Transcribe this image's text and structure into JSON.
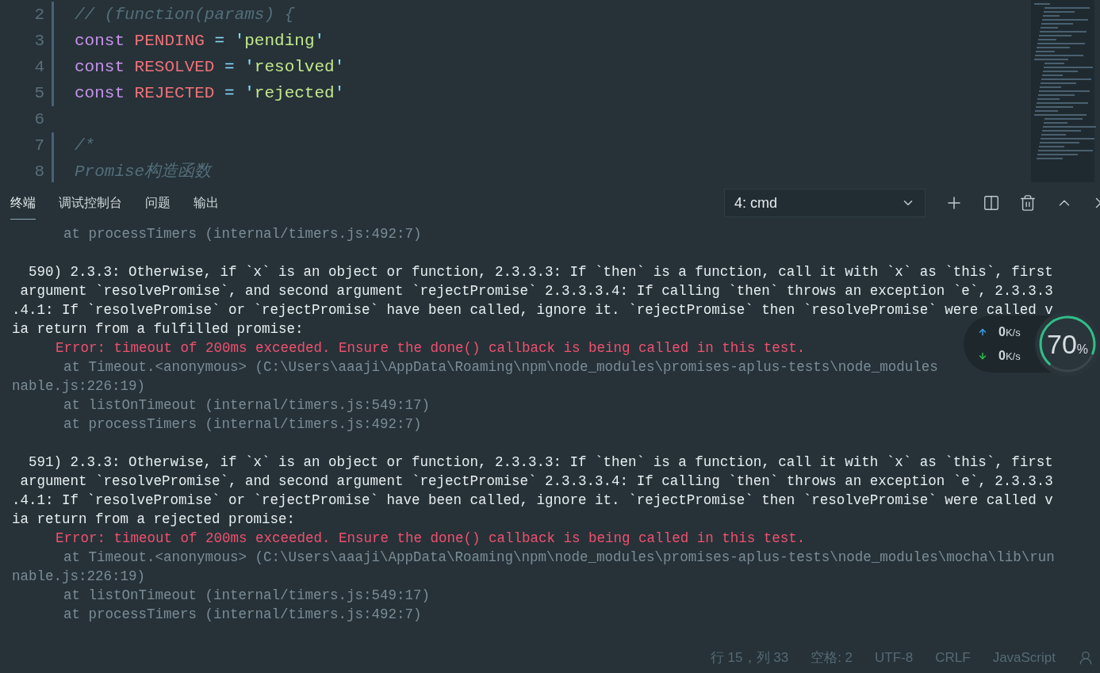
{
  "editor": {
    "lines": [
      {
        "number": "2",
        "tokens": [
          {
            "text": "// (function(params) {",
            "kind": "comment"
          }
        ]
      },
      {
        "number": "3",
        "tokens": [
          {
            "text": "const",
            "kind": "keyword"
          },
          {
            "text": " PENDING",
            "kind": "constant"
          },
          {
            "text": " = ",
            "kind": "operator"
          },
          {
            "text": "'",
            "kind": "operator"
          },
          {
            "text": "pending",
            "kind": "string"
          },
          {
            "text": "'",
            "kind": "operator"
          }
        ]
      },
      {
        "number": "4",
        "tokens": [
          {
            "text": "const",
            "kind": "keyword"
          },
          {
            "text": " RESOLVED",
            "kind": "constant"
          },
          {
            "text": " = ",
            "kind": "operator"
          },
          {
            "text": "'",
            "kind": "operator"
          },
          {
            "text": "resolved",
            "kind": "string"
          },
          {
            "text": "'",
            "kind": "operator"
          }
        ]
      },
      {
        "number": "5",
        "tokens": [
          {
            "text": "const",
            "kind": "keyword"
          },
          {
            "text": " REJECTED",
            "kind": "constant"
          },
          {
            "text": " = ",
            "kind": "operator"
          },
          {
            "text": "'",
            "kind": "operator"
          },
          {
            "text": "rejected",
            "kind": "string"
          },
          {
            "text": "'",
            "kind": "operator"
          }
        ]
      },
      {
        "number": "6"
      },
      {
        "number": "7",
        "tokens": [
          {
            "text": "/*",
            "kind": "comment"
          }
        ]
      },
      {
        "number": "8",
        "tokens": [
          {
            "text": "Promise构造函数",
            "kind": "comment"
          }
        ]
      }
    ]
  },
  "panel": {
    "tabs": [
      {
        "label": "终端",
        "selected": true
      },
      {
        "label": "调试控制台",
        "selected": false
      },
      {
        "label": "问题",
        "selected": false
      },
      {
        "label": "输出",
        "selected": false
      }
    ],
    "terminal_select": "4: cmd",
    "lines": [
      {
        "kind": "trace",
        "text": "at processTimers (internal/timers.js:492:7)"
      },
      {
        "kind": "blank"
      },
      {
        "kind": "head",
        "text": "590) 2.3.3: Otherwise, if `x` is an object or function, 2.3.3.3: If `then` is a function, call it with `x` as `this`, first"
      },
      {
        "kind": "wrap",
        "text": " argument `resolvePromise`, and second argument `rejectPromise` 2.3.3.3.4: If calling `then` throws an exception `e`, 2.3.3.3"
      },
      {
        "kind": "wrap",
        "text": ".4.1: If `resolvePromise` or `rejectPromise` have been called, ignore it. `rejectPromise` then `resolvePromise` were called v"
      },
      {
        "kind": "wrap",
        "text": "ia return from a fulfilled promise:"
      },
      {
        "kind": "error",
        "text": "Error: timeout of 200ms exceeded. Ensure the done() callback is being called in this test."
      },
      {
        "kind": "trace",
        "text": "at Timeout.<anonymous> (C:\\Users\\aaaji\\AppData\\Roaming\\npm\\node_modules\\promises-aplus-tests\\node_modules"
      },
      {
        "kind": "wrap-trace",
        "text": "nable.js:226:19)"
      },
      {
        "kind": "trace",
        "text": "at listOnTimeout (internal/timers.js:549:17)"
      },
      {
        "kind": "trace",
        "text": "at processTimers (internal/timers.js:492:7)"
      },
      {
        "kind": "blank"
      },
      {
        "kind": "head",
        "text": "591) 2.3.3: Otherwise, if `x` is an object or function, 2.3.3.3: If `then` is a function, call it with `x` as `this`, first"
      },
      {
        "kind": "wrap",
        "text": " argument `resolvePromise`, and second argument `rejectPromise` 2.3.3.3.4: If calling `then` throws an exception `e`, 2.3.3.3"
      },
      {
        "kind": "wrap",
        "text": ".4.1: If `resolvePromise` or `rejectPromise` have been called, ignore it. `rejectPromise` then `resolvePromise` were called v"
      },
      {
        "kind": "wrap",
        "text": "ia return from a rejected promise:"
      },
      {
        "kind": "error",
        "text": "Error: timeout of 200ms exceeded. Ensure the done() callback is being called in this test."
      },
      {
        "kind": "trace",
        "text": "at Timeout.<anonymous> (C:\\Users\\aaaji\\AppData\\Roaming\\npm\\node_modules\\promises-aplus-tests\\node_modules\\mocha\\lib\\run"
      },
      {
        "kind": "wrap-trace",
        "text": "nable.js:226:19)"
      },
      {
        "kind": "trace",
        "text": "at listOnTimeout (internal/timers.js:549:17)"
      },
      {
        "kind": "trace",
        "text": "at processTimers (internal/timers.js:492:7)"
      }
    ]
  },
  "net_widget": {
    "upload": "0",
    "download": "0",
    "unit_up": "K/s",
    "unit_down": "K/s",
    "value": "70",
    "percent": "%",
    "level": 0.7
  },
  "status_bar": {
    "items": [
      "行 15，列 33",
      "空格: 2",
      "UTF-8",
      "CRLF",
      "JavaScript"
    ]
  }
}
